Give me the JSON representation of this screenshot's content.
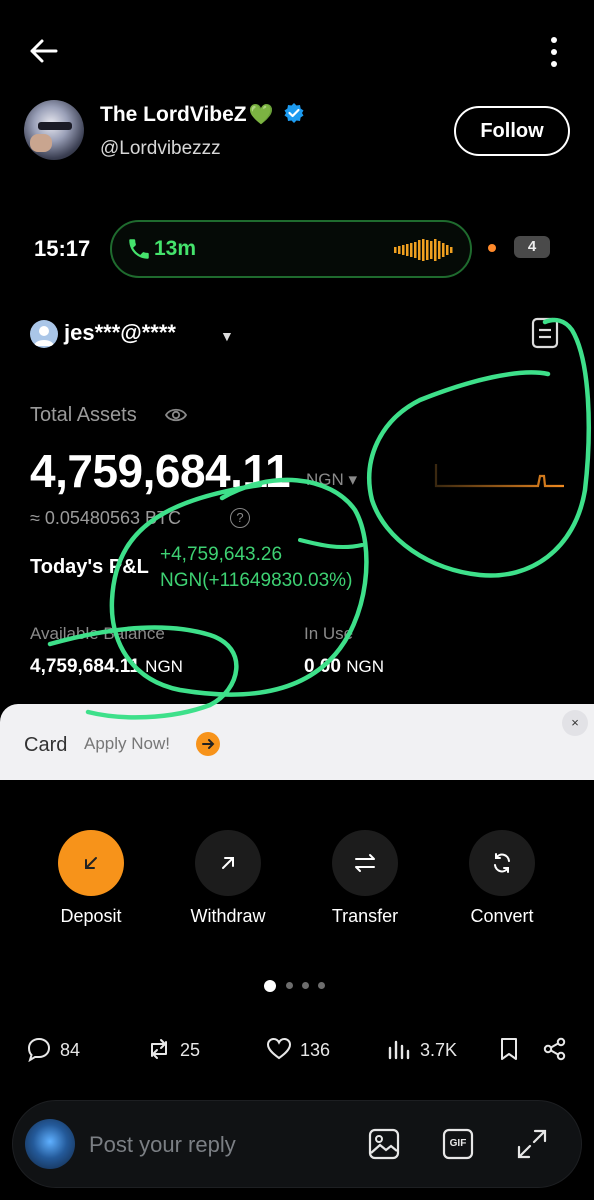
{
  "post": {
    "author_name": "The LordVibeZ",
    "author_emoji": "💚",
    "author_handle": "@Lordvibezzz",
    "follow_label": "Follow"
  },
  "screenshot": {
    "status_time": "15:17",
    "call_duration": "13m",
    "notification_count": "4",
    "account_label": "jes***@****",
    "total_assets_label": "Total Assets",
    "total_assets_value": "4,759,684.11",
    "total_assets_currency": "NGN ▾",
    "btc_equivalent": "≈ 0.05480563 BTC",
    "pnl_label": "Today's P&L",
    "pnl_value_line1": "+4,759,643.26",
    "pnl_value_line2": "NGN(+11649830.03%)",
    "available_label": "Available Balance",
    "available_value": "4,759,684.11",
    "available_unit": "NGN",
    "in_use_label": "In Use",
    "in_use_value": "0.00",
    "in_use_unit": "NGN",
    "promo_title": "Card",
    "promo_cta": "Apply Now!",
    "promo_close": "×"
  },
  "actions": [
    {
      "label": "Deposit"
    },
    {
      "label": "Withdraw"
    },
    {
      "label": "Transfer"
    },
    {
      "label": "Convert"
    }
  ],
  "engagement": {
    "replies": "84",
    "reposts": "25",
    "likes": "136",
    "views": "3.7K"
  },
  "reply_bar": {
    "placeholder": "Post your reply",
    "gif_label": "GIF"
  },
  "colors": {
    "accent_green": "#3ed173",
    "accent_orange": "#f7931a",
    "verified_blue": "#1d9bf0",
    "scribble_green": "#3ee08a"
  }
}
